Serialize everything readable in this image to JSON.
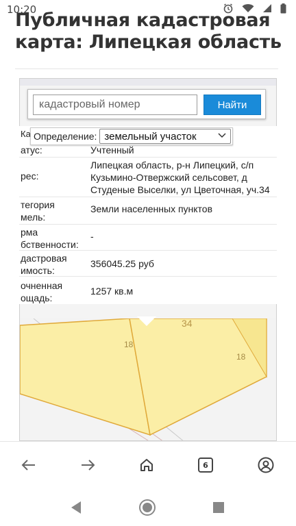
{
  "status_bar": {
    "time": "10:20",
    "icons": [
      "alarm-icon",
      "wifi-icon",
      "signal-icon",
      "battery-icon"
    ]
  },
  "page": {
    "title": "Публичная кадастровая карта: Липецкая область"
  },
  "search": {
    "placeholder": "кадастровый номер",
    "button_label": "Найти"
  },
  "definition": {
    "label": "Определение:",
    "selected": "земельный участок",
    "cut_label": "Кад. н"
  },
  "info_rows": [
    {
      "key": "Статус:",
      "value": "Учтенный"
    },
    {
      "key": "Адрес:",
      "value": "Липецкая область, р-н Липецкий, с/п Кузьмино-Отвержский сельсовет, д Студеные Выселки, ул Цветочная, уч.34"
    },
    {
      "key": "Категория земель:",
      "value": "Земли населенных пунктов"
    },
    {
      "key": "Форма собственности:",
      "value": "-"
    },
    {
      "key": "Кадастровая стоимость:",
      "value": "356045.25 руб"
    },
    {
      "key": "Уточненная площадь:",
      "value": "1257 кв.м"
    }
  ],
  "info_keys_visible": [
    "атус:",
    "рес:",
    "тегория\nмель:",
    "рма\nбственности:",
    "дастровая\nимость:",
    "очненная\nощадь:"
  ],
  "map": {
    "parcel_labels": [
      "34",
      "18",
      "18"
    ],
    "parcel_fill": "#fbeea6",
    "parcel_stroke": "#e0a93a"
  },
  "bottom_nav": {
    "tab_count": "6",
    "icons": [
      "back-arrow-icon",
      "forward-arrow-icon",
      "home-icon",
      "tabs-icon",
      "profile-icon"
    ]
  },
  "system_nav": {
    "icons": [
      "back-triangle-icon",
      "home-circle-icon",
      "recents-square-icon"
    ]
  },
  "colors": {
    "accent": "#1a8bd9",
    "text": "#222222"
  }
}
